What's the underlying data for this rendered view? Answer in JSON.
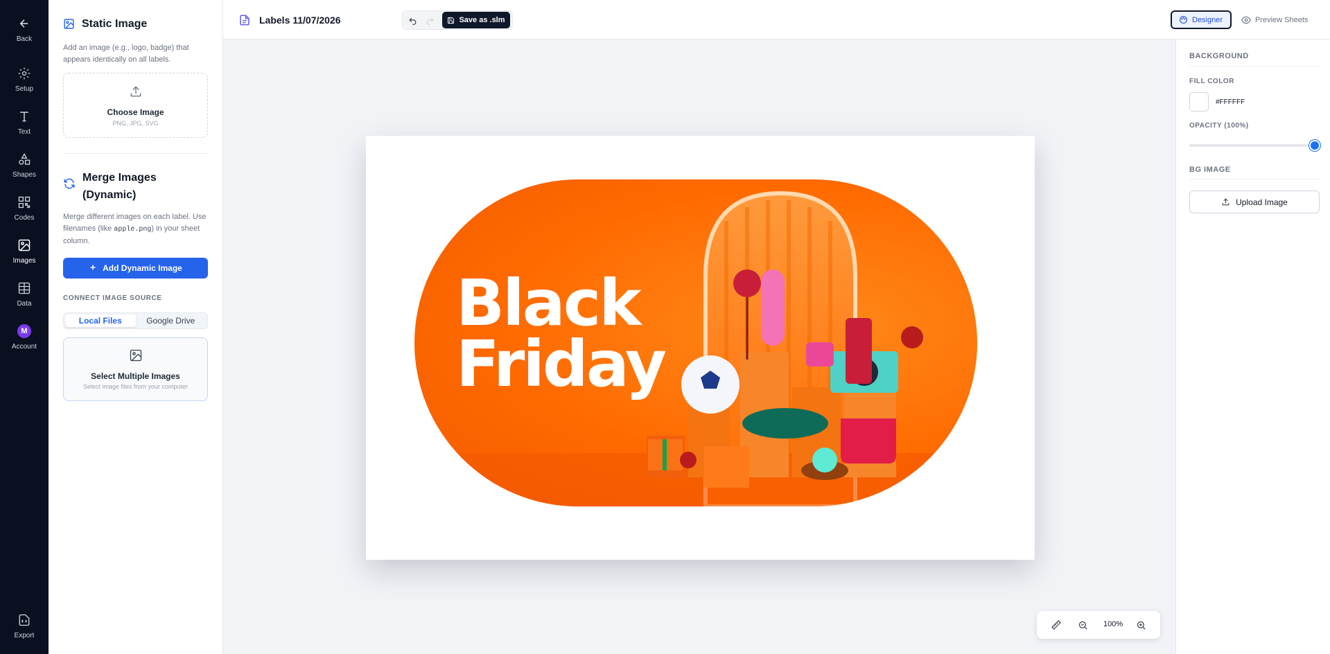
{
  "rail": {
    "back": "Back",
    "setup": "Setup",
    "text": "Text",
    "shapes": "Shapes",
    "codes": "Codes",
    "images": "Images",
    "data": "Data",
    "account": "Account",
    "account_initial": "M",
    "export": "Export"
  },
  "panel": {
    "static_title": "Static Image",
    "static_desc_1": "Add an image (e.g., logo, badge) that",
    "static_desc_2": "appears identically on all labels.",
    "choose_label": "Choose Image",
    "choose_types": "PNG, JPG, SVG",
    "merge_title_1": "Merge Images",
    "merge_title_2": "(Dynamic)",
    "merge_desc_1": "Merge different images on each label. Use",
    "merge_desc_2a": "filenames (like ",
    "merge_desc_2b": "apple.png",
    "merge_desc_2c": ") in your sheet",
    "merge_desc_3": "column.",
    "add_dynamic": "Add Dynamic Image",
    "connect_source": "CONNECT IMAGE SOURCE",
    "source_local": "Local Files",
    "source_drive": "Google Drive",
    "select_multiple": "Select Multiple Images",
    "select_multiple_sub": "Select image files from your computer"
  },
  "topbar": {
    "doc_title": "Labels 11/07/2026",
    "save_label": "Save as .slm",
    "designer": "Designer",
    "preview": "Preview Sheets"
  },
  "canvas": {
    "headline_1": "Black",
    "headline_2": "Friday",
    "zoom": "100%"
  },
  "right": {
    "background": "BACKGROUND",
    "fill_color": "FILL COLOR",
    "fill_hex": "#FFFFFF",
    "opacity": "OPACITY (100%)",
    "opacity_value": 1.0,
    "bg_image": "BG IMAGE",
    "upload": "Upload Image"
  },
  "colors": {
    "accent": "#2563eb",
    "rail_bg": "#0b1020",
    "banner_orange": "#ff6a00"
  }
}
